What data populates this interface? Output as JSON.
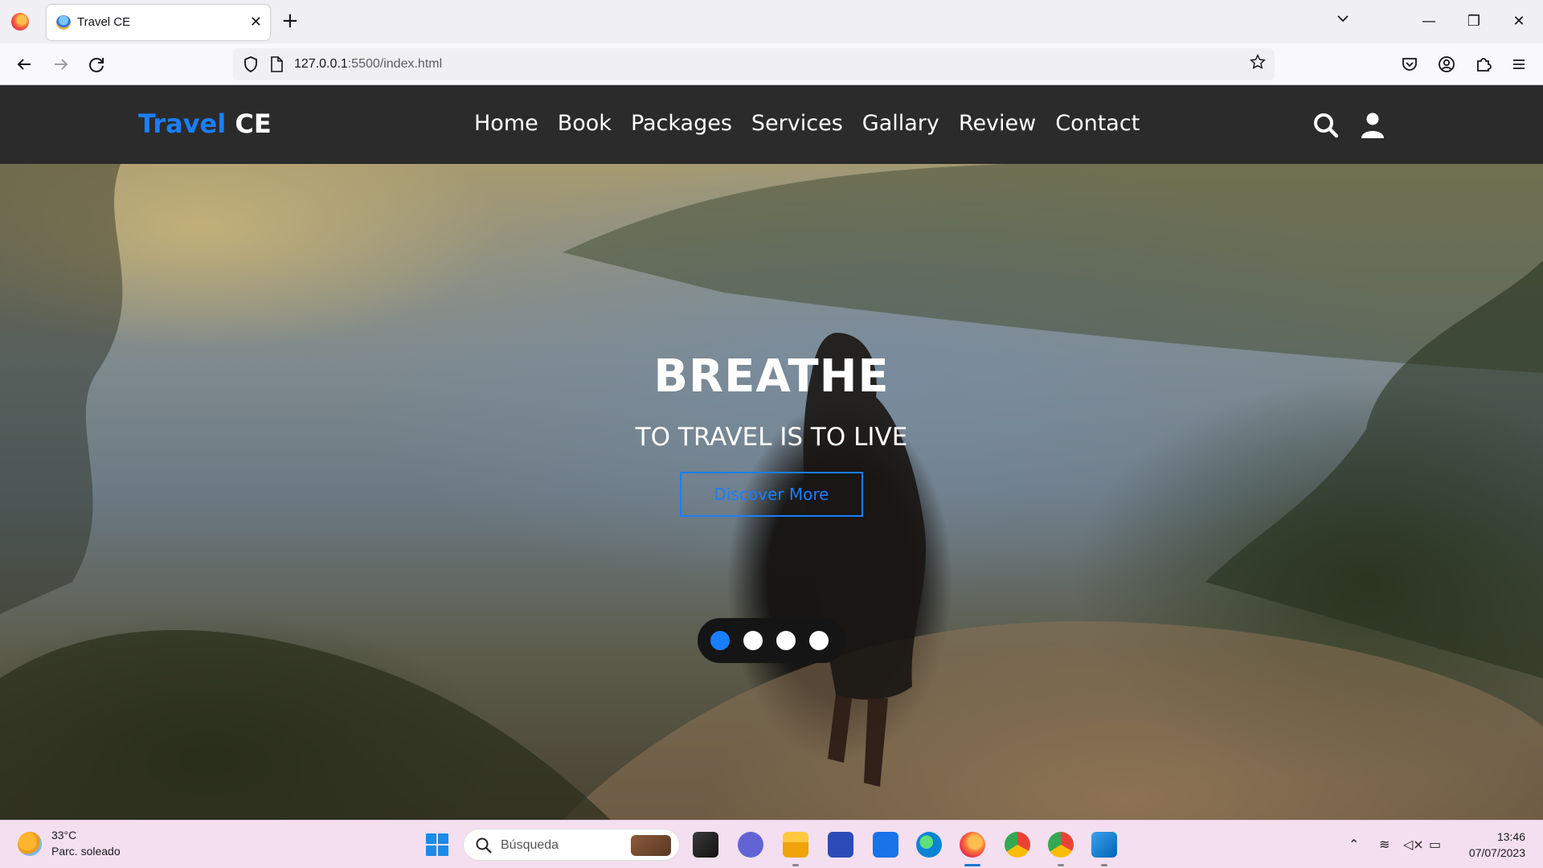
{
  "browser": {
    "tab_title": "Travel CE",
    "tab_close": "✕",
    "new_tab": "+",
    "url_host": "127.0.0.1",
    "url_rest": ":5500/index.html",
    "window_minimize": "—",
    "window_restore": "❐",
    "window_close": "✕"
  },
  "site": {
    "brand_part1": "Travel",
    "brand_part2": "CE",
    "menu": [
      "Home",
      "Book",
      "Packages",
      "Services",
      "Gallary",
      "Review",
      "Contact"
    ],
    "accent_color": "#1a7fff",
    "header_bg": "#2b2b2b",
    "hero": {
      "title": "BREATHE",
      "subtitle": "TO TRAVEL IS TO LIVE",
      "button_label": "Discover More",
      "slider_count": 4,
      "active_slide": 1
    }
  },
  "taskbar": {
    "temperature": "33°C",
    "condition": "Parc. soleado",
    "search_label": "Búsqueda",
    "time": "13:46",
    "date": "07/07/2023"
  }
}
